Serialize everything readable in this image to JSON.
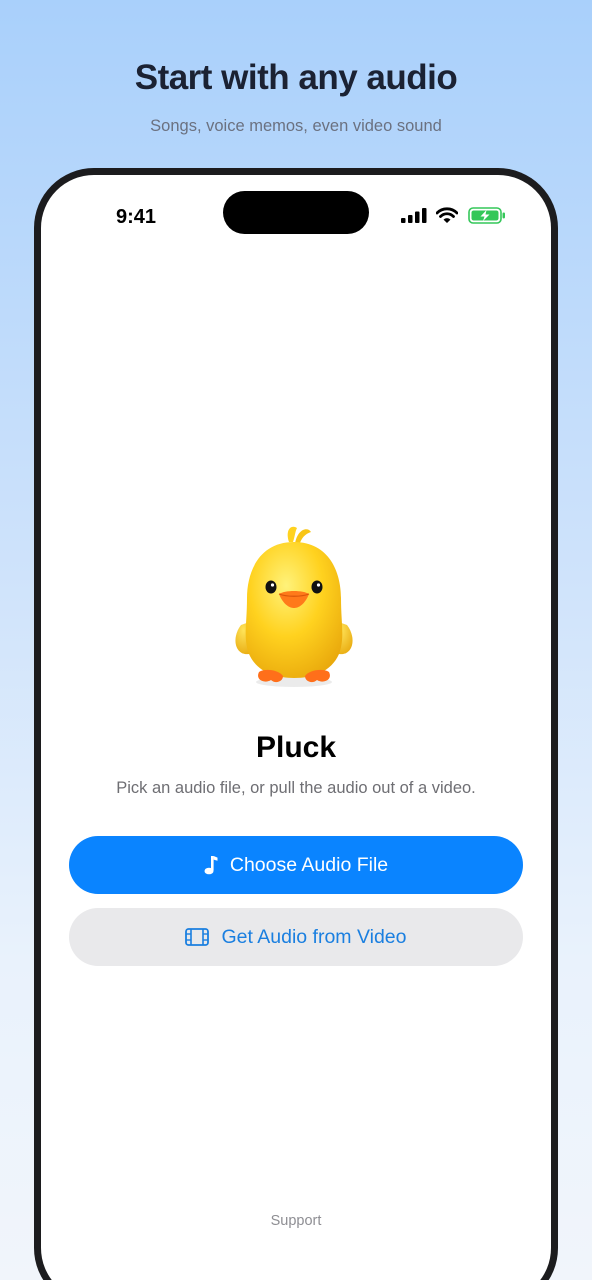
{
  "header": {
    "title": "Start with any audio",
    "subtitle": "Songs, voice memos, even video sound"
  },
  "status_bar": {
    "time": "9:41",
    "icons": [
      "cellular-signal-icon",
      "wifi-icon",
      "battery-charging-icon"
    ]
  },
  "app": {
    "mascot": "yellow-chick-illustration",
    "title": "Pluck",
    "subtitle": "Pick an audio file, or pull the audio out of a video.",
    "primary_button": {
      "label": "Choose Audio File",
      "icon": "music-note-icon"
    },
    "secondary_button": {
      "label": "Get Audio from Video",
      "icon": "film-icon"
    },
    "support_link": "Support"
  },
  "colors": {
    "accent": "#0a84ff",
    "secondary_button_bg": "#e9e9eb",
    "secondary_button_text": "#1a7fe0",
    "battery": "#34c759",
    "background_top": "#a9d0fb"
  }
}
